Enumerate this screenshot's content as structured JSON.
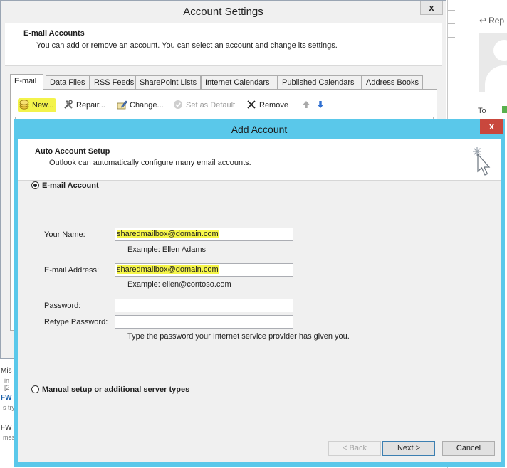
{
  "background": {
    "reply_label": "Rep",
    "to_label": "To",
    "left_items": [
      "Mis",
      "in [2",
      "FW",
      "s try",
      "FW",
      "mes"
    ]
  },
  "account_settings": {
    "title": "Account Settings",
    "close_glyph": "x",
    "header_title": "E-mail Accounts",
    "header_desc": "You can add or remove an account. You can select an account and change its settings.",
    "tabs": [
      {
        "label": "E-mail"
      },
      {
        "label": "Data Files"
      },
      {
        "label": "RSS Feeds"
      },
      {
        "label": "SharePoint Lists"
      },
      {
        "label": "Internet Calendars"
      },
      {
        "label": "Published Calendars"
      },
      {
        "label": "Address Books"
      }
    ],
    "toolbar": {
      "new": "New...",
      "repair": "Repair...",
      "change": "Change...",
      "set_default": "Set as Default",
      "remove": "Remove"
    }
  },
  "add_account": {
    "title": "Add Account",
    "close_glyph": "x",
    "header_title": "Auto Account Setup",
    "header_desc": "Outlook can automatically configure many email accounts.",
    "radio_email": "E-mail Account",
    "radio_manual": "Manual setup or additional server types",
    "fields": {
      "name_label": "Your Name:",
      "name_value": "sharedmailbox@domain.com",
      "name_example": "Example: Ellen Adams",
      "email_label": "E-mail Address:",
      "email_value": "sharedmailbox@domain.com",
      "email_example": "Example: ellen@contoso.com",
      "password_label": "Password:",
      "retype_label": "Retype Password:",
      "password_hint": "Type the password your Internet service provider has given you."
    },
    "buttons": {
      "back": "< Back",
      "next": "Next >",
      "cancel": "Cancel"
    }
  },
  "colors": {
    "dialog_frame": "#5ac8ea",
    "close_red": "#c9473d",
    "highlight": "#f6f64a"
  }
}
